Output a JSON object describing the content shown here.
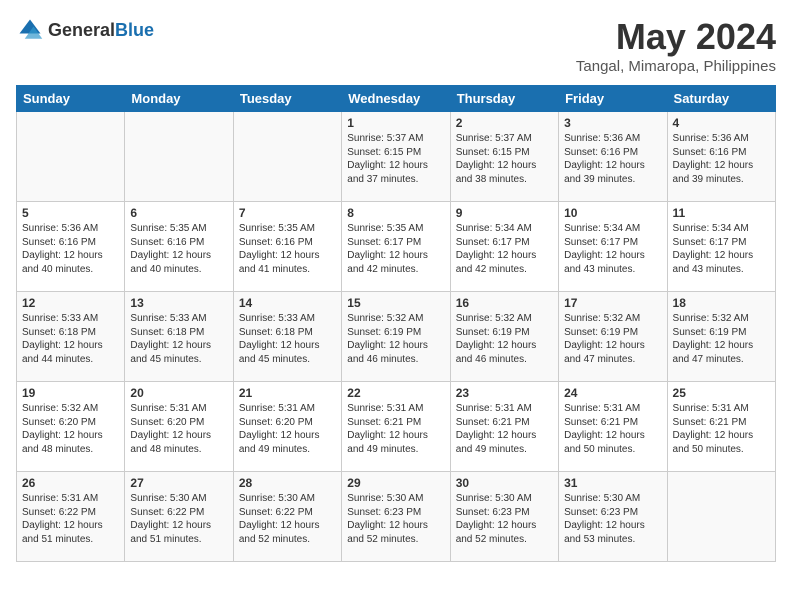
{
  "header": {
    "logo_general": "General",
    "logo_blue": "Blue",
    "month_year": "May 2024",
    "location": "Tangal, Mimaropa, Philippines"
  },
  "days_of_week": [
    "Sunday",
    "Monday",
    "Tuesday",
    "Wednesday",
    "Thursday",
    "Friday",
    "Saturday"
  ],
  "weeks": [
    [
      {
        "day": "",
        "info": ""
      },
      {
        "day": "",
        "info": ""
      },
      {
        "day": "",
        "info": ""
      },
      {
        "day": "1",
        "info": "Sunrise: 5:37 AM\nSunset: 6:15 PM\nDaylight: 12 hours\nand 37 minutes."
      },
      {
        "day": "2",
        "info": "Sunrise: 5:37 AM\nSunset: 6:15 PM\nDaylight: 12 hours\nand 38 minutes."
      },
      {
        "day": "3",
        "info": "Sunrise: 5:36 AM\nSunset: 6:16 PM\nDaylight: 12 hours\nand 39 minutes."
      },
      {
        "day": "4",
        "info": "Sunrise: 5:36 AM\nSunset: 6:16 PM\nDaylight: 12 hours\nand 39 minutes."
      }
    ],
    [
      {
        "day": "5",
        "info": "Sunrise: 5:36 AM\nSunset: 6:16 PM\nDaylight: 12 hours\nand 40 minutes."
      },
      {
        "day": "6",
        "info": "Sunrise: 5:35 AM\nSunset: 6:16 PM\nDaylight: 12 hours\nand 40 minutes."
      },
      {
        "day": "7",
        "info": "Sunrise: 5:35 AM\nSunset: 6:16 PM\nDaylight: 12 hours\nand 41 minutes."
      },
      {
        "day": "8",
        "info": "Sunrise: 5:35 AM\nSunset: 6:17 PM\nDaylight: 12 hours\nand 42 minutes."
      },
      {
        "day": "9",
        "info": "Sunrise: 5:34 AM\nSunset: 6:17 PM\nDaylight: 12 hours\nand 42 minutes."
      },
      {
        "day": "10",
        "info": "Sunrise: 5:34 AM\nSunset: 6:17 PM\nDaylight: 12 hours\nand 43 minutes."
      },
      {
        "day": "11",
        "info": "Sunrise: 5:34 AM\nSunset: 6:17 PM\nDaylight: 12 hours\nand 43 minutes."
      }
    ],
    [
      {
        "day": "12",
        "info": "Sunrise: 5:33 AM\nSunset: 6:18 PM\nDaylight: 12 hours\nand 44 minutes."
      },
      {
        "day": "13",
        "info": "Sunrise: 5:33 AM\nSunset: 6:18 PM\nDaylight: 12 hours\nand 45 minutes."
      },
      {
        "day": "14",
        "info": "Sunrise: 5:33 AM\nSunset: 6:18 PM\nDaylight: 12 hours\nand 45 minutes."
      },
      {
        "day": "15",
        "info": "Sunrise: 5:32 AM\nSunset: 6:19 PM\nDaylight: 12 hours\nand 46 minutes."
      },
      {
        "day": "16",
        "info": "Sunrise: 5:32 AM\nSunset: 6:19 PM\nDaylight: 12 hours\nand 46 minutes."
      },
      {
        "day": "17",
        "info": "Sunrise: 5:32 AM\nSunset: 6:19 PM\nDaylight: 12 hours\nand 47 minutes."
      },
      {
        "day": "18",
        "info": "Sunrise: 5:32 AM\nSunset: 6:19 PM\nDaylight: 12 hours\nand 47 minutes."
      }
    ],
    [
      {
        "day": "19",
        "info": "Sunrise: 5:32 AM\nSunset: 6:20 PM\nDaylight: 12 hours\nand 48 minutes."
      },
      {
        "day": "20",
        "info": "Sunrise: 5:31 AM\nSunset: 6:20 PM\nDaylight: 12 hours\nand 48 minutes."
      },
      {
        "day": "21",
        "info": "Sunrise: 5:31 AM\nSunset: 6:20 PM\nDaylight: 12 hours\nand 49 minutes."
      },
      {
        "day": "22",
        "info": "Sunrise: 5:31 AM\nSunset: 6:21 PM\nDaylight: 12 hours\nand 49 minutes."
      },
      {
        "day": "23",
        "info": "Sunrise: 5:31 AM\nSunset: 6:21 PM\nDaylight: 12 hours\nand 49 minutes."
      },
      {
        "day": "24",
        "info": "Sunrise: 5:31 AM\nSunset: 6:21 PM\nDaylight: 12 hours\nand 50 minutes."
      },
      {
        "day": "25",
        "info": "Sunrise: 5:31 AM\nSunset: 6:21 PM\nDaylight: 12 hours\nand 50 minutes."
      }
    ],
    [
      {
        "day": "26",
        "info": "Sunrise: 5:31 AM\nSunset: 6:22 PM\nDaylight: 12 hours\nand 51 minutes."
      },
      {
        "day": "27",
        "info": "Sunrise: 5:30 AM\nSunset: 6:22 PM\nDaylight: 12 hours\nand 51 minutes."
      },
      {
        "day": "28",
        "info": "Sunrise: 5:30 AM\nSunset: 6:22 PM\nDaylight: 12 hours\nand 52 minutes."
      },
      {
        "day": "29",
        "info": "Sunrise: 5:30 AM\nSunset: 6:23 PM\nDaylight: 12 hours\nand 52 minutes."
      },
      {
        "day": "30",
        "info": "Sunrise: 5:30 AM\nSunset: 6:23 PM\nDaylight: 12 hours\nand 52 minutes."
      },
      {
        "day": "31",
        "info": "Sunrise: 5:30 AM\nSunset: 6:23 PM\nDaylight: 12 hours\nand 53 minutes."
      },
      {
        "day": "",
        "info": ""
      }
    ]
  ]
}
